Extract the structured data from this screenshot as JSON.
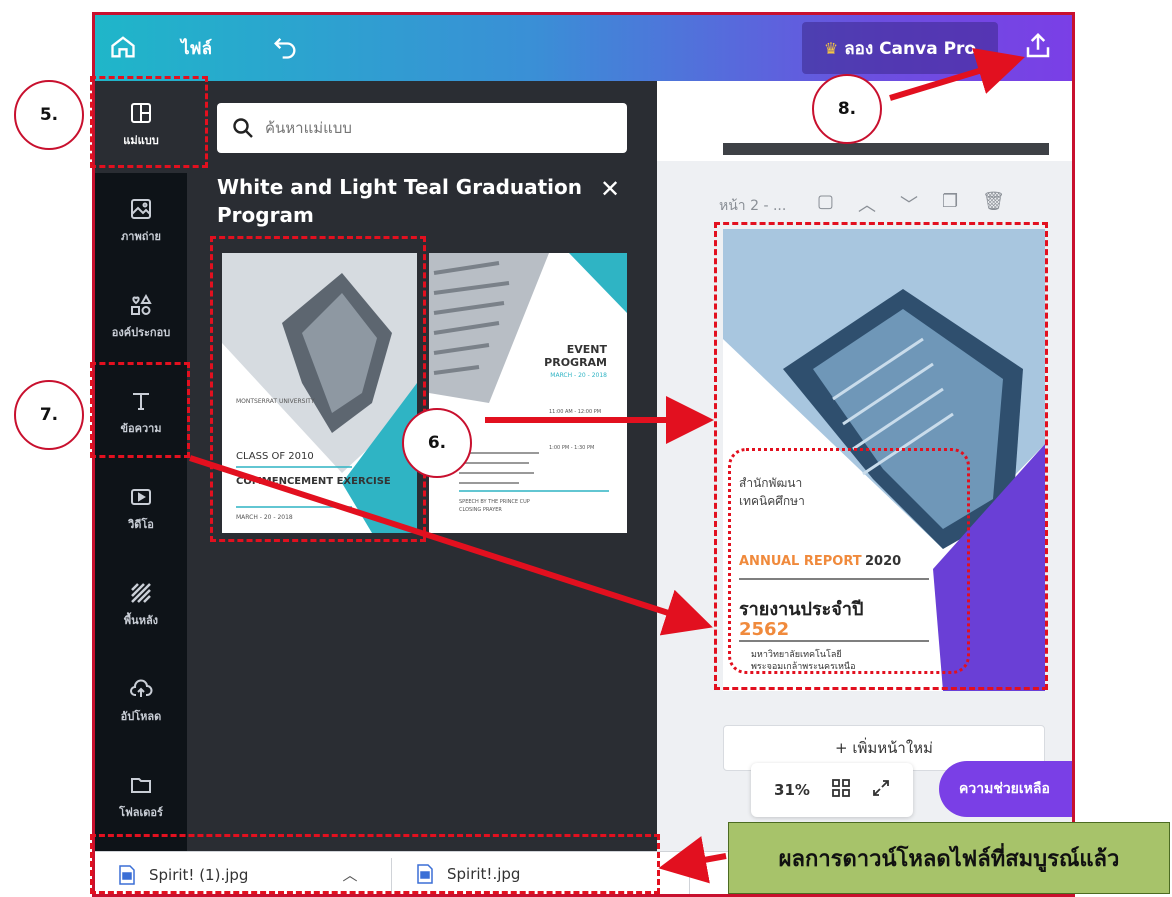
{
  "topbar": {
    "file_label": "ไฟล์",
    "pro_label": "ลอง Canva Pro"
  },
  "sidebar": {
    "items": [
      {
        "label": "แม่แบบ",
        "icon": "template-icon"
      },
      {
        "label": "ภาพถ่าย",
        "icon": "photo-icon"
      },
      {
        "label": "องค์ประกอบ",
        "icon": "elements-icon"
      },
      {
        "label": "ข้อความ",
        "icon": "text-icon"
      },
      {
        "label": "วิดีโอ",
        "icon": "video-icon"
      },
      {
        "label": "พื้นหลัง",
        "icon": "background-icon"
      },
      {
        "label": "อัปโหลด",
        "icon": "upload-icon"
      },
      {
        "label": "โฟลเดอร์",
        "icon": "folder-icon"
      }
    ]
  },
  "panel": {
    "search_placeholder": "ค้นหาแม่แบบ",
    "title": "White and Light Teal Graduation Program",
    "templates": [
      {
        "name": "commencement-exercise",
        "university": "MONTSERRAT UNIVERSITY",
        "class_line": "CLASS OF 2010",
        "heading": "COMMENCEMENT EXERCISE",
        "date": "MARCH - 20 - 2018"
      },
      {
        "name": "event-program",
        "heading_line1": "EVENT",
        "heading_line2": "PROGRAM",
        "date": "MARCH - 20 - 2018",
        "time1": "11:00 AM - 12:00 PM",
        "time2": "1:00 PM - 1:30 PM",
        "speech_line1": "SPEECH BY THE PRINCE CUP",
        "speech_line2": "CLOSING PRAYER"
      }
    ]
  },
  "canvas": {
    "page_label": "หน้า 2 - ...",
    "page": {
      "org_line1": "สำนักพัฒนา",
      "org_line2": "เทคนิคศึกษา",
      "annual_report": "ANNUAL REPORT",
      "annual_year": "2020",
      "title_th": "รายงานประจำปี",
      "year_th": "2562",
      "univ_line1": "มหาวิทยาลัยเทคโนโลยี",
      "univ_line2": "พระจอมเกล้าพระนครเหนือ"
    },
    "add_page_label": "+ เพิ่มหน้าใหม่",
    "zoom_level": "31%",
    "help_label": "ความช่วยเหลือ"
  },
  "downloads": {
    "files": [
      {
        "name": "Spirit! (1).jpg"
      },
      {
        "name": "Spirit!.jpg"
      }
    ]
  },
  "annotations": {
    "c5": "5.",
    "c6": "6.",
    "c7": "7.",
    "c8": "8.",
    "download_result": "ผลการดาวน์โหลดไฟล์ที่สมบูรณ์แล้ว"
  },
  "colors": {
    "accent_purple": "#7a3fe6",
    "teal": "#2fb4c4",
    "orange": "#f08a3c",
    "annotation_red": "#e2101f"
  }
}
